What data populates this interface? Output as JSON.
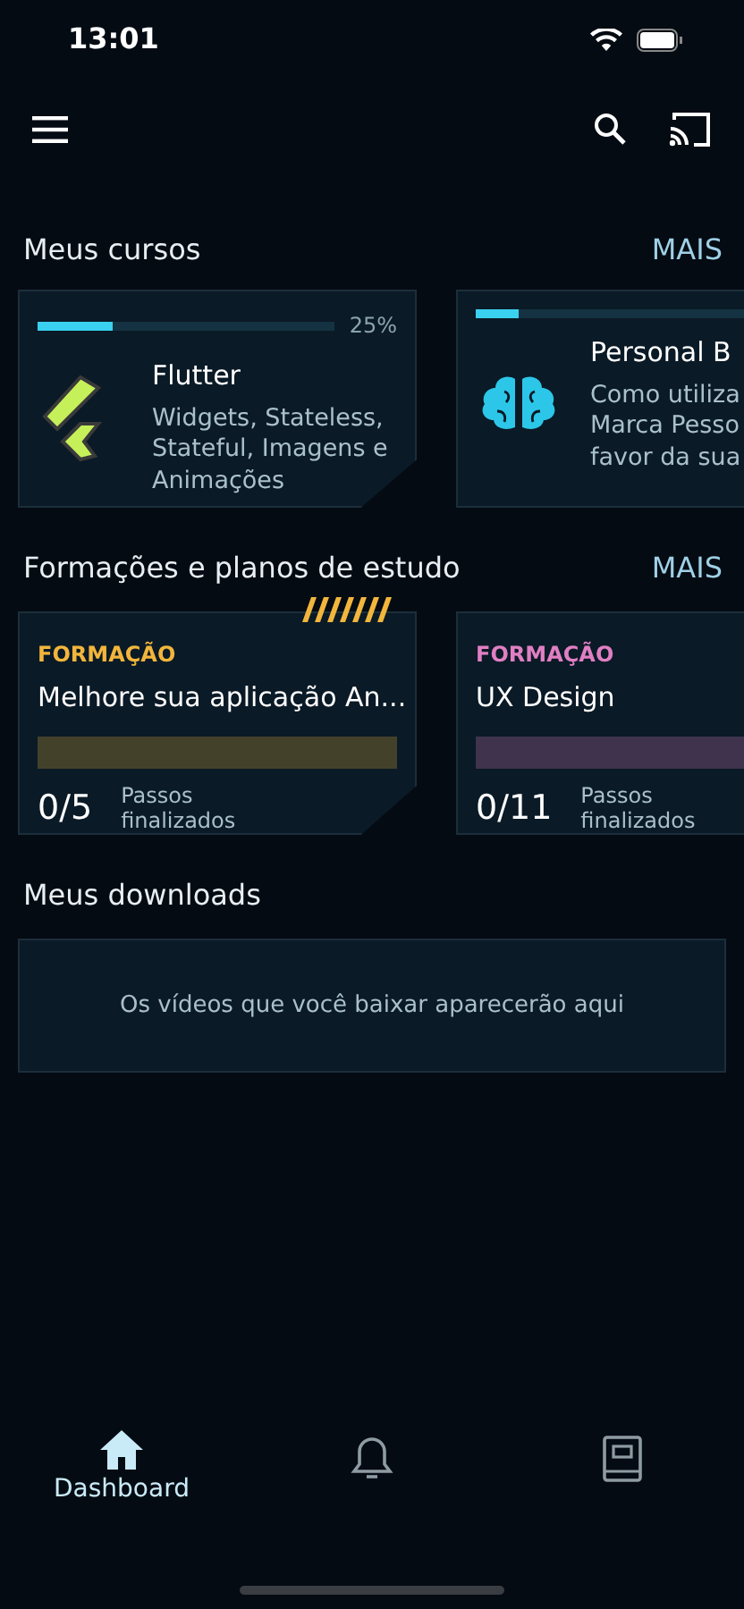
{
  "status_bar": {
    "time": "13:01"
  },
  "sections": [
    {
      "title": "Meus cursos",
      "action": "MAIS"
    },
    {
      "title": "Formações e planos de estudo",
      "action": "MAIS"
    },
    {
      "title": "Meus downloads"
    }
  ],
  "courses": [
    {
      "title": "Flutter",
      "description_lines": [
        "Widgets, Stateless,",
        "Stateful, Imagens e",
        "Animações"
      ],
      "level": 0.25,
      "percent": "25%"
    },
    {
      "title": "Personal B",
      "description_lines": [
        "Como utiliza",
        "Marca Pesso",
        "favor da sua"
      ],
      "level": 0.1
    }
  ],
  "formations": [
    {
      "label": "FORMAÇÃO",
      "title": "Melhore sua aplicação An...",
      "color": "#f2b63c",
      "level": 0,
      "steps": "0/5",
      "steps_label": "Passos finalizados",
      "highlighted": true
    },
    {
      "label": "FORMAÇÃO",
      "title": "UX Design",
      "color": "#e07fc3",
      "level": 0,
      "steps": "0/11",
      "steps_label": "Passos finalizados",
      "highlighted": false
    }
  ],
  "downloads": {
    "empty_message": "Os vídeos que você baixar aparecerão aqui"
  },
  "bottom_nav": [
    {
      "label": "Dashboard",
      "selected": true
    },
    {
      "selected": false
    },
    {
      "selected": false
    }
  ]
}
